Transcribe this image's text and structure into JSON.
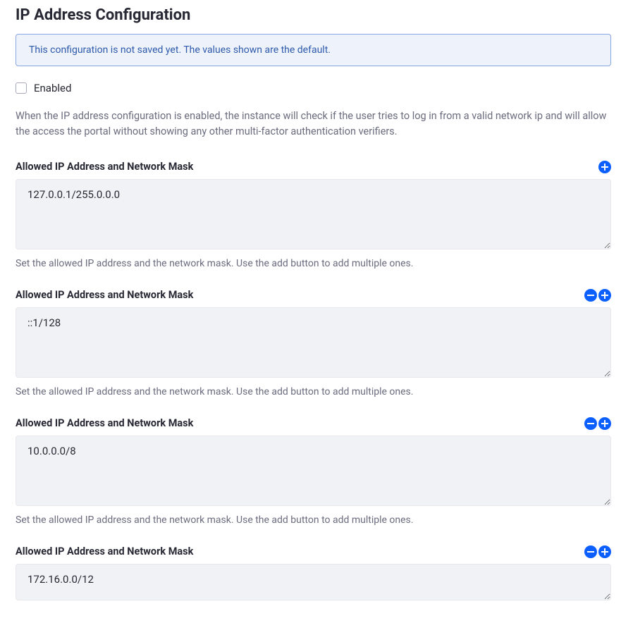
{
  "page": {
    "title": "IP Address Configuration"
  },
  "banner": {
    "message": "This configuration is not saved yet. The values shown are the default."
  },
  "enabled": {
    "label": "Enabled",
    "checked": false
  },
  "description": "When the IP address configuration is enabled, the instance will check if the user tries to log in from a valid network ip and will allow the access the portal without showing any other multi-factor authentication verifiers.",
  "fields": [
    {
      "label": "Allowed IP Address and Network Mask",
      "value": "127.0.0.1/255.0.0.0",
      "help": "Set the allowed IP address and the network mask. Use the add button to add multiple ones.",
      "showRemove": false
    },
    {
      "label": "Allowed IP Address and Network Mask",
      "value": "::1/128",
      "help": "Set the allowed IP address and the network mask. Use the add button to add multiple ones.",
      "showRemove": true
    },
    {
      "label": "Allowed IP Address and Network Mask",
      "value": "10.0.0.0/8",
      "help": "Set the allowed IP address and the network mask. Use the add button to add multiple ones.",
      "showRemove": true
    },
    {
      "label": "Allowed IP Address and Network Mask",
      "value": "172.16.0.0/12",
      "help": "",
      "showRemove": true,
      "short": true
    }
  ]
}
